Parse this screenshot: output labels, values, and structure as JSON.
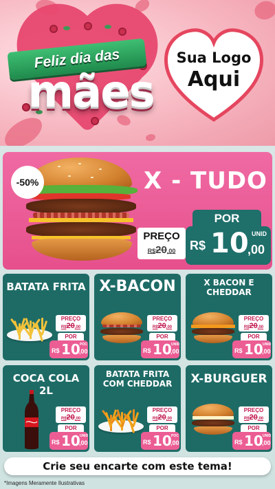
{
  "header": {
    "title_line1": "Feliz dia das",
    "title_line2": "mães",
    "logo_line1": "Sua Logo",
    "logo_line2": "Aqui"
  },
  "featured": {
    "discount": "-50%",
    "name": "X - TUDO",
    "preco_label": "PREÇO",
    "old_currency": "R$",
    "old_int": "20",
    "old_dec": ",00",
    "por_label": "POR",
    "currency": "R$",
    "price_int": "10",
    "price_dec": ",00",
    "unit": "UNID"
  },
  "products": [
    {
      "name": "BATATA FRITA",
      "preco_label": "PREÇO",
      "old_currency": "R$",
      "old_int": "20",
      "old_dec": ",00",
      "por_label": "POR",
      "currency": "R$",
      "price_int": "10",
      "price_dec": ",00",
      "unit": "POC"
    },
    {
      "name": "X-BACON",
      "preco_label": "PREÇO",
      "old_currency": "R$",
      "old_int": "20",
      "old_dec": ",00",
      "por_label": "POR",
      "currency": "R$",
      "price_int": "10",
      "price_dec": ",00",
      "unit": "UNID"
    },
    {
      "name": "X BACON E CHEDDAR",
      "preco_label": "PREÇO",
      "old_currency": "R$",
      "old_int": "20",
      "old_dec": ",00",
      "por_label": "POR",
      "currency": "R$",
      "price_int": "10",
      "price_dec": ",00",
      "unit": "UNID"
    },
    {
      "name": "COCA COLA 2L",
      "preco_label": "PREÇO",
      "old_currency": "R$",
      "old_int": "20",
      "old_dec": ",00",
      "por_label": "POR",
      "currency": "R$",
      "price_int": "10",
      "price_dec": ",00",
      "unit": "UNID"
    },
    {
      "name": "BATATA FRITA COM CHEDDAR",
      "preco_label": "PREÇO",
      "old_currency": "R$",
      "old_int": "20",
      "old_dec": ",00",
      "por_label": "POR",
      "currency": "R$",
      "price_int": "10",
      "price_dec": ",00",
      "unit": "POC"
    },
    {
      "name": "X-BURGUER",
      "preco_label": "PREÇO",
      "old_currency": "R$",
      "old_int": "20",
      "old_dec": ",00",
      "por_label": "POR",
      "currency": "R$",
      "price_int": "10",
      "price_dec": ",00",
      "unit": "UNID"
    }
  ],
  "footer": {
    "cta": "Crie seu encarte com este tema!",
    "disclaimer": "*Imagens Meramente Ilustrativas"
  },
  "colors": {
    "pink": "#e6508c",
    "teal": "#1e6b66",
    "price_pink": "#ec5d94",
    "green_ribbon": "#1f8a4c"
  }
}
